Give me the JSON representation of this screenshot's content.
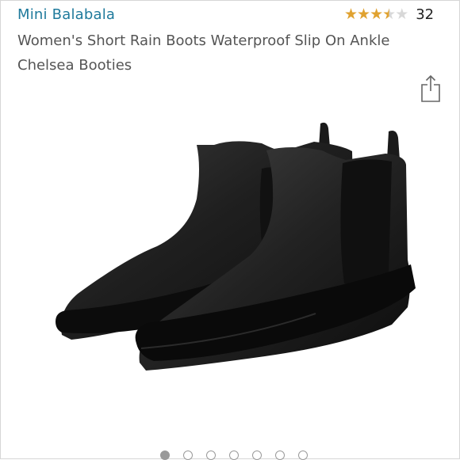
{
  "product": {
    "brand": "Mini Balabala",
    "title_line1": "Women's Short Rain Boots Waterproof Slip On Ankle",
    "title_line2": "Chelsea Booties",
    "rating": 3.5,
    "rating_max": 5,
    "review_count": "32",
    "image_icon": "black-chelsea-rain-boots-image"
  },
  "carousel": {
    "total": 7,
    "active_index": 0
  },
  "colors": {
    "brand_link": "#1f7a9c",
    "star": "#e0a230",
    "star_empty": "#d8d8d8"
  },
  "icons": {
    "share": "share-icon"
  }
}
